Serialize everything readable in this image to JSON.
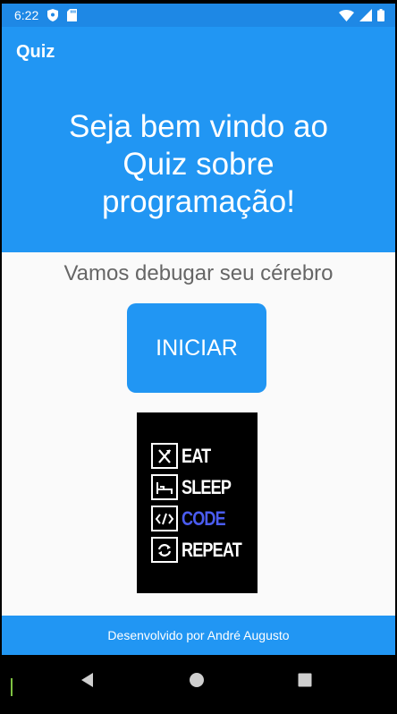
{
  "status_bar": {
    "time": "6:22",
    "left_icons": [
      "shield-icon",
      "sd-card-icon"
    ],
    "right_icons": [
      "wifi-icon",
      "signal-icon",
      "battery-icon"
    ]
  },
  "app_bar": {
    "title": "Quiz"
  },
  "hero": {
    "title": "Seja bem vindo ao Quiz sobre programação!"
  },
  "subtitle": "Vamos debugar seu cérebro",
  "start_button": {
    "label": "INICIAR"
  },
  "poster": {
    "rows": [
      {
        "icon": "fork-knife-icon",
        "word": "EAT"
      },
      {
        "icon": "bed-icon",
        "word": "SLEEP"
      },
      {
        "icon": "code-icon",
        "word": "CODE"
      },
      {
        "icon": "refresh-icon",
        "word": "REPEAT"
      }
    ]
  },
  "footer": {
    "text": "Desenvolvido por André Augusto"
  },
  "nav_bar": {
    "buttons": [
      "back-icon",
      "home-icon",
      "recents-icon"
    ]
  },
  "colors": {
    "primary": "#2196f3",
    "status": "#1e88e5",
    "code_word": "#4a5cf0"
  }
}
